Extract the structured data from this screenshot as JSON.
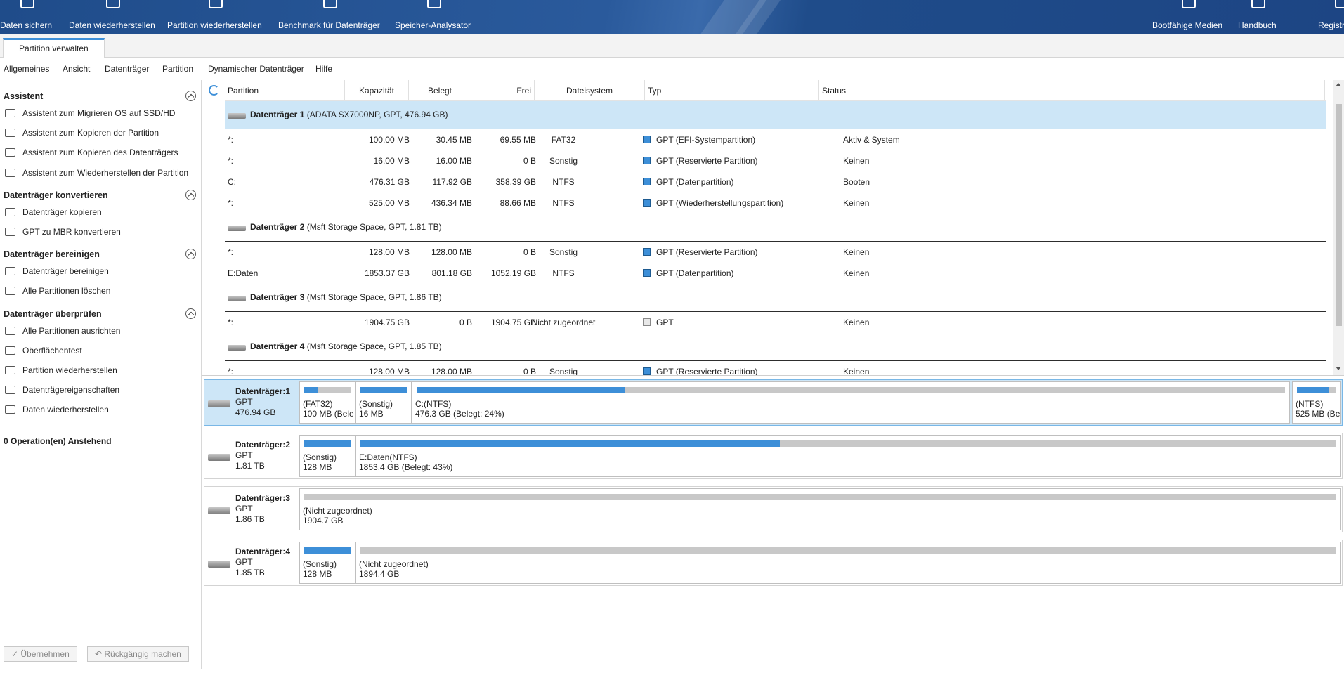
{
  "toolbar": {
    "left": [
      {
        "label": "Daten sichern",
        "icon": "backup-icon"
      },
      {
        "label": "Daten wiederherstellen",
        "icon": "data-recovery-icon"
      },
      {
        "label": "Partition wiederherstellen",
        "icon": "partition-recovery-icon"
      },
      {
        "label": "Benchmark für Datenträger",
        "icon": "benchmark-icon"
      },
      {
        "label": "Speicher-Analysator",
        "icon": "space-analyzer-icon"
      }
    ],
    "right": [
      {
        "label": "Bootfähige Medien",
        "icon": "bootable-media-icon"
      },
      {
        "label": "Handbuch",
        "icon": "manual-icon"
      },
      {
        "label": "Registrieren",
        "icon": "register-icon"
      }
    ]
  },
  "tab": {
    "label": "Partition verwalten"
  },
  "menu": [
    "Allgemeines",
    "Ansicht",
    "Datenträger",
    "Partition",
    "Dynamischer Datenträger",
    "Hilfe"
  ],
  "sidebar": {
    "sections": [
      {
        "title": "Assistent",
        "items": [
          "Assistent zum Migrieren OS auf SSD/HD",
          "Assistent zum Kopieren der Partition",
          "Assistent zum Kopieren des Datenträgers",
          "Assistent zum Wiederherstellen der Partition"
        ]
      },
      {
        "title": "Datenträger konvertieren",
        "items": [
          "Datenträger kopieren",
          "GPT zu MBR konvertieren"
        ]
      },
      {
        "title": "Datenträger bereinigen",
        "items": [
          "Datenträger bereinigen",
          "Alle Partitionen löschen"
        ]
      },
      {
        "title": "Datenträger überprüfen",
        "items": [
          "Alle Partitionen ausrichten",
          "Oberflächentest",
          "Partition wiederherstellen",
          "Datenträgereigenschaften",
          "Daten wiederherstellen"
        ]
      }
    ],
    "pending": "0 Operation(en) Anstehend",
    "apply_label": "✓  Übernehmen",
    "undo_label": "↶  Rückgängig machen"
  },
  "table": {
    "headers": [
      "Partition",
      "Kapazität",
      "Belegt",
      "Frei",
      "Dateisystem",
      "Typ",
      "Status"
    ],
    "disks": [
      {
        "name": "Datenträger 1",
        "detail": " (ADATA SX7000NP, GPT, 476.94 GB)",
        "selected": true,
        "partitions": [
          [
            "*:",
            "100.00 MB",
            "30.45 MB",
            "69.55 MB",
            "FAT32",
            "GPT (EFI-Systempartition)",
            "Aktiv & System"
          ],
          [
            "*:",
            "16.00 MB",
            "16.00 MB",
            "0 B",
            "Sonstig",
            "GPT (Reservierte Partition)",
            "Keinen"
          ],
          [
            "C:",
            "476.31 GB",
            "117.92 GB",
            "358.39 GB",
            "NTFS",
            "GPT (Datenpartition)",
            "Booten"
          ],
          [
            "*:",
            "525.00 MB",
            "436.34 MB",
            "88.66 MB",
            "NTFS",
            "GPT (Wiederherstellungspartition)",
            "Keinen"
          ]
        ]
      },
      {
        "name": "Datenträger 2",
        "detail": " (Msft Storage Space, GPT, 1.81 TB)",
        "selected": false,
        "partitions": [
          [
            "*:",
            "128.00 MB",
            "128.00 MB",
            "0 B",
            "Sonstig",
            "GPT (Reservierte Partition)",
            "Keinen"
          ],
          [
            "E:Daten",
            "1853.37 GB",
            "801.18 GB",
            "1052.19 GB",
            "NTFS",
            "GPT (Datenpartition)",
            "Keinen"
          ]
        ]
      },
      {
        "name": "Datenträger 3",
        "detail": " (Msft Storage Space, GPT, 1.86 TB)",
        "selected": false,
        "partitions": [
          [
            "*:",
            "1904.75 GB",
            "0 B",
            "1904.75 GB",
            "Nicht zugeordnet",
            "GPT",
            "Keinen"
          ]
        ]
      },
      {
        "name": "Datenträger 4",
        "detail": " (Msft Storage Space, GPT, 1.85 TB)",
        "selected": false,
        "partitions": [
          [
            "*:",
            "128.00 MB",
            "128.00 MB",
            "0 B",
            "Sonstig",
            "GPT (Reservierte Partition)",
            "Keinen"
          ]
        ]
      }
    ]
  },
  "diskmap": [
    {
      "name": "Datenträger:1",
      "type": "GPT",
      "size": "476.94 GB",
      "selected": true,
      "segments": [
        {
          "l1": "(FAT32)",
          "l2": "100 MB (Bele",
          "used": 0.3
        },
        {
          "l1": "(Sonstig)",
          "l2": "16 MB",
          "used": 1.0
        },
        {
          "l1": "C:(NTFS)",
          "l2": "476.3 GB (Belegt: 24%)",
          "used": 0.24
        },
        {
          "l1": "(NTFS)",
          "l2": "525 MB (Bele",
          "used": 0.83
        }
      ]
    },
    {
      "name": "Datenträger:2",
      "type": "GPT",
      "size": "1.81 TB",
      "selected": false,
      "segments": [
        {
          "l1": "(Sonstig)",
          "l2": "128 MB",
          "used": 1.0
        },
        {
          "l1": "E:Daten(NTFS)",
          "l2": "1853.4 GB (Belegt: 43%)",
          "used": 0.43
        }
      ]
    },
    {
      "name": "Datenträger:3",
      "type": "GPT",
      "size": "1.86 TB",
      "selected": false,
      "segments": [
        {
          "l1": "(Nicht zugeordnet)",
          "l2": "1904.7 GB",
          "used": 0
        }
      ]
    },
    {
      "name": "Datenträger:4",
      "type": "GPT",
      "size": "1.85 TB",
      "selected": false,
      "segments": [
        {
          "l1": "(Sonstig)",
          "l2": "128 MB",
          "used": 1.0
        },
        {
          "l1": "(Nicht zugeordnet)",
          "l2": "1894.4 GB",
          "used": 0
        }
      ]
    }
  ]
}
